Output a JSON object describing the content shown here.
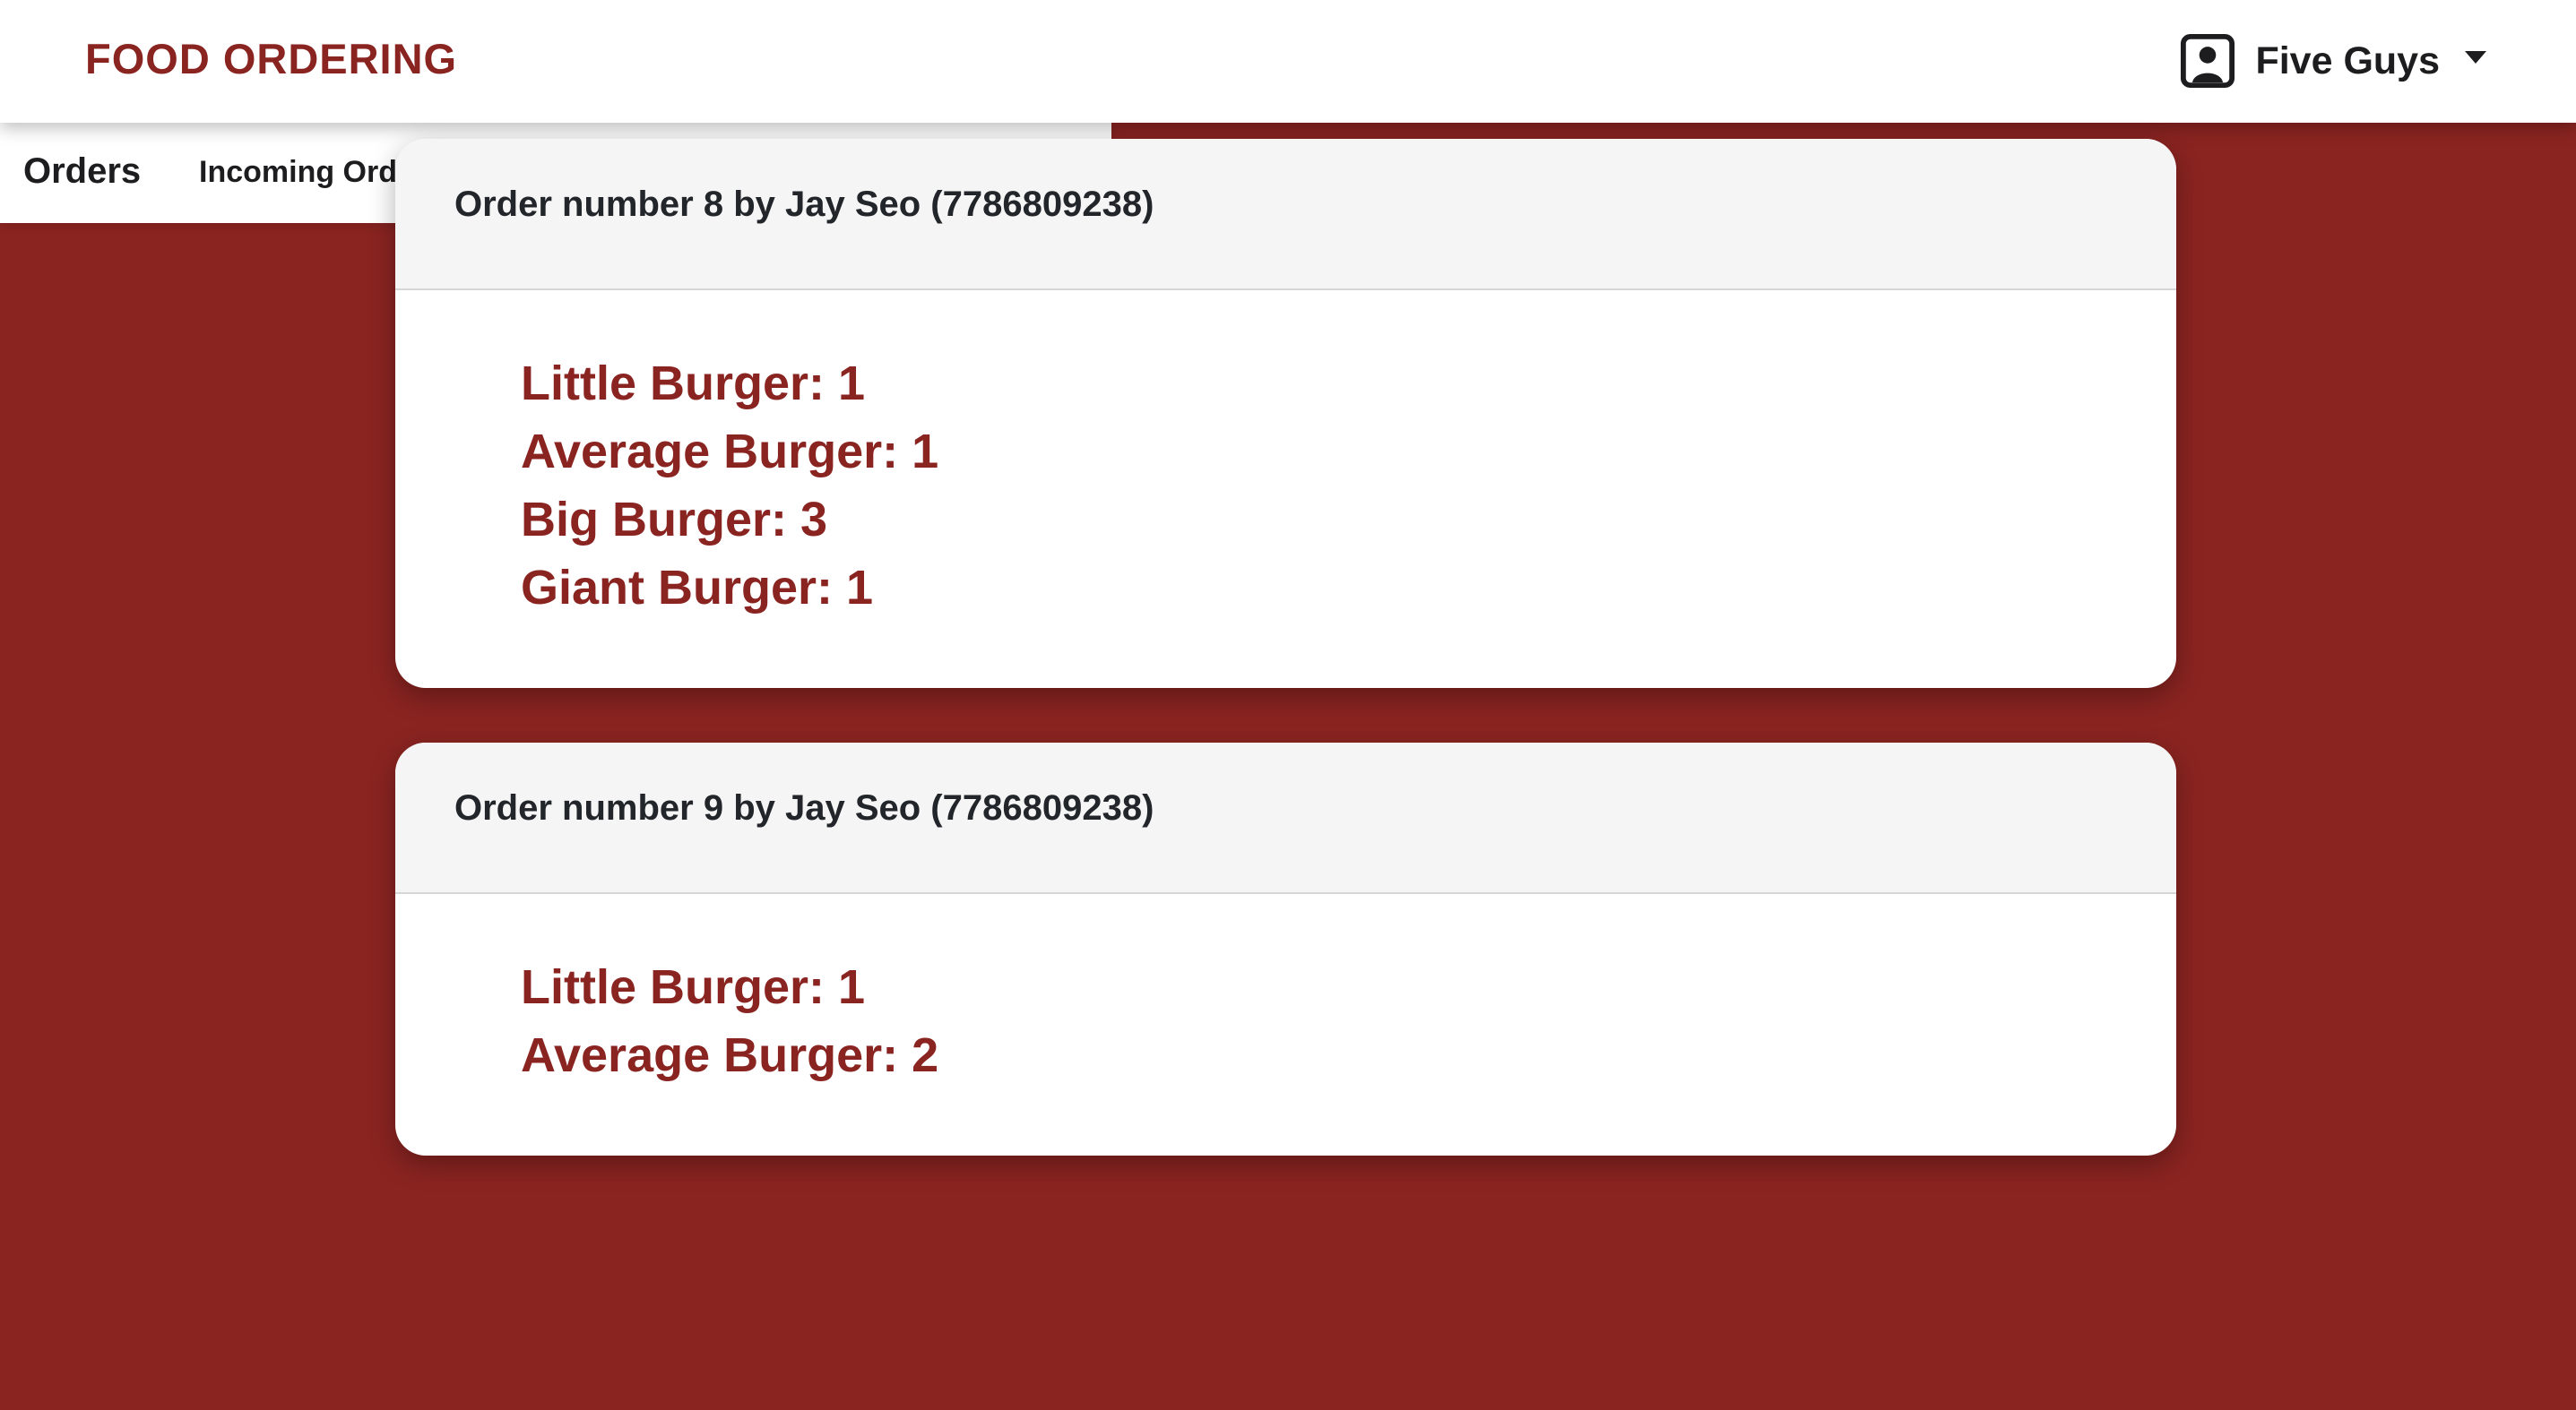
{
  "app": {
    "brand": "FOOD ORDERING"
  },
  "user_menu": {
    "name": "Five Guys",
    "icon": "person-square-icon"
  },
  "subnav": {
    "brand": "Orders",
    "link": "Incoming Orders"
  },
  "colors": {
    "brand": "#8a2421",
    "background": "#8a2421",
    "card_header": "#f5f5f5"
  },
  "orders": [
    {
      "title": "Order number 8 by Jay Seo (7786809238)",
      "items": [
        "Little Burger: 1",
        "Average Burger: 1",
        "Big Burger: 3",
        "Giant Burger: 1"
      ]
    },
    {
      "title": "Order number 9 by Jay Seo (7786809238)",
      "items": [
        "Little Burger: 1",
        "Average Burger: 2"
      ]
    }
  ]
}
